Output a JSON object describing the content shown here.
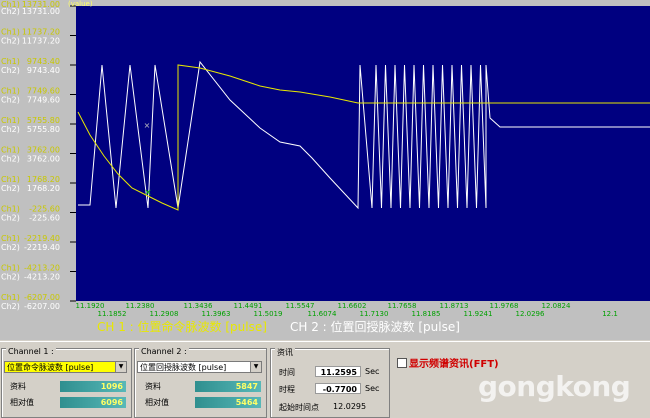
{
  "chart_data": {
    "type": "line",
    "ylabel": "(value)",
    "y_ticks": [
      13731.0,
      11737.2,
      9743.4,
      7749.6,
      5755.8,
      3762.0,
      1768.2,
      -225.6,
      -2219.4,
      -4213.2,
      -6207.0
    ],
    "x_ticks_top": [
      "11.1920",
      "11.2380",
      "11.3436",
      "11.4491",
      "11.5547",
      "11.6602",
      "11.7658",
      "11.8713",
      "11.9768",
      "12.0824"
    ],
    "x_ticks_bottom": [
      "11.1852",
      "11.2908",
      "11.3963",
      "11.5019",
      "11.6074",
      "11.7130",
      "11.8185",
      "11.9241",
      "12.0296",
      "12.1"
    ],
    "xlim": [
      11.1852,
      12.135
    ],
    "ylim": [
      -6207.0,
      13731.0
    ],
    "series": [
      {
        "name": "CH 1 : 位置命令脉波数 [pulse]",
        "color": "#e8e800"
      },
      {
        "name": "CH 2 : 位置回授脉波数 [pulse]",
        "color": "#ffffff"
      }
    ]
  },
  "y_axis_label": "(value)",
  "y_ticks": [
    {
      "ch1": "13731.00",
      "ch2": "13731.00"
    },
    {
      "ch1": "11737.20",
      "ch2": "11737.20"
    },
    {
      "ch1": "9743.40",
      "ch2": "9743.40"
    },
    {
      "ch1": "7749.60",
      "ch2": "7749.60"
    },
    {
      "ch1": "5755.80",
      "ch2": "5755.80"
    },
    {
      "ch1": "3762.00",
      "ch2": "3762.00"
    },
    {
      "ch1": "1768.20",
      "ch2": "1768.20"
    },
    {
      "ch1": "-225.60",
      "ch2": "-225.60"
    },
    {
      "ch1": "-2219.40",
      "ch2": "-2219.40"
    },
    {
      "ch1": "-4213.20",
      "ch2": "-4213.20"
    },
    {
      "ch1": "-6207.00",
      "ch2": "-6207.00"
    }
  ],
  "ch1_prefix": "Ch1)",
  "ch2_prefix": "Ch2)",
  "x_ticks_top": [
    "11.1920",
    "11.2380",
    "11.3436",
    "11.4491",
    "11.5547",
    "11.6602",
    "11.7658",
    "11.8713",
    "11.9768",
    "12.0824"
  ],
  "x_ticks_bottom": [
    "11.1852",
    "11.2908",
    "11.3963",
    "11.5019",
    "11.6074",
    "11.7130",
    "11.8185",
    "11.9241",
    "12.0296",
    "12.1"
  ],
  "legend": {
    "ch1": "CH 1 : 位置命令脉波数 [pulse]",
    "ch2": "CH 2 : 位置回授脉波数 [pulse]"
  },
  "channel1": {
    "title": "Channel 1 :",
    "select_value": "位置命令脉波数 [pulse]",
    "data_label": "资料",
    "data_value": "1096",
    "rel_label": "相对值",
    "rel_value": "6096"
  },
  "channel2": {
    "title": "Channel 2 :",
    "select_value": "位置回授脉波数 [pulse]",
    "data_label": "资料",
    "data_value": "5847",
    "rel_label": "相对值",
    "rel_value": "5464"
  },
  "info": {
    "title": "资讯",
    "time_label": "时间",
    "time_value": "11.2595",
    "time_unit": "Sec",
    "range_label": "时程",
    "range_value": "-0.7700",
    "range_unit": "Sec",
    "start_label": "起始时间点",
    "start_value": "12.0295"
  },
  "fft": {
    "label": "显示频谱资讯(FFT)",
    "checked": false
  },
  "colors": {
    "plot_bg": "#000080",
    "ch1": "#e8e800",
    "ch2": "#ffffff",
    "axis_text_ch1": "#c8c800",
    "axis_text_ch2": "#ffffff",
    "x_tick_text": "#00a000"
  },
  "watermark": "gongkong"
}
